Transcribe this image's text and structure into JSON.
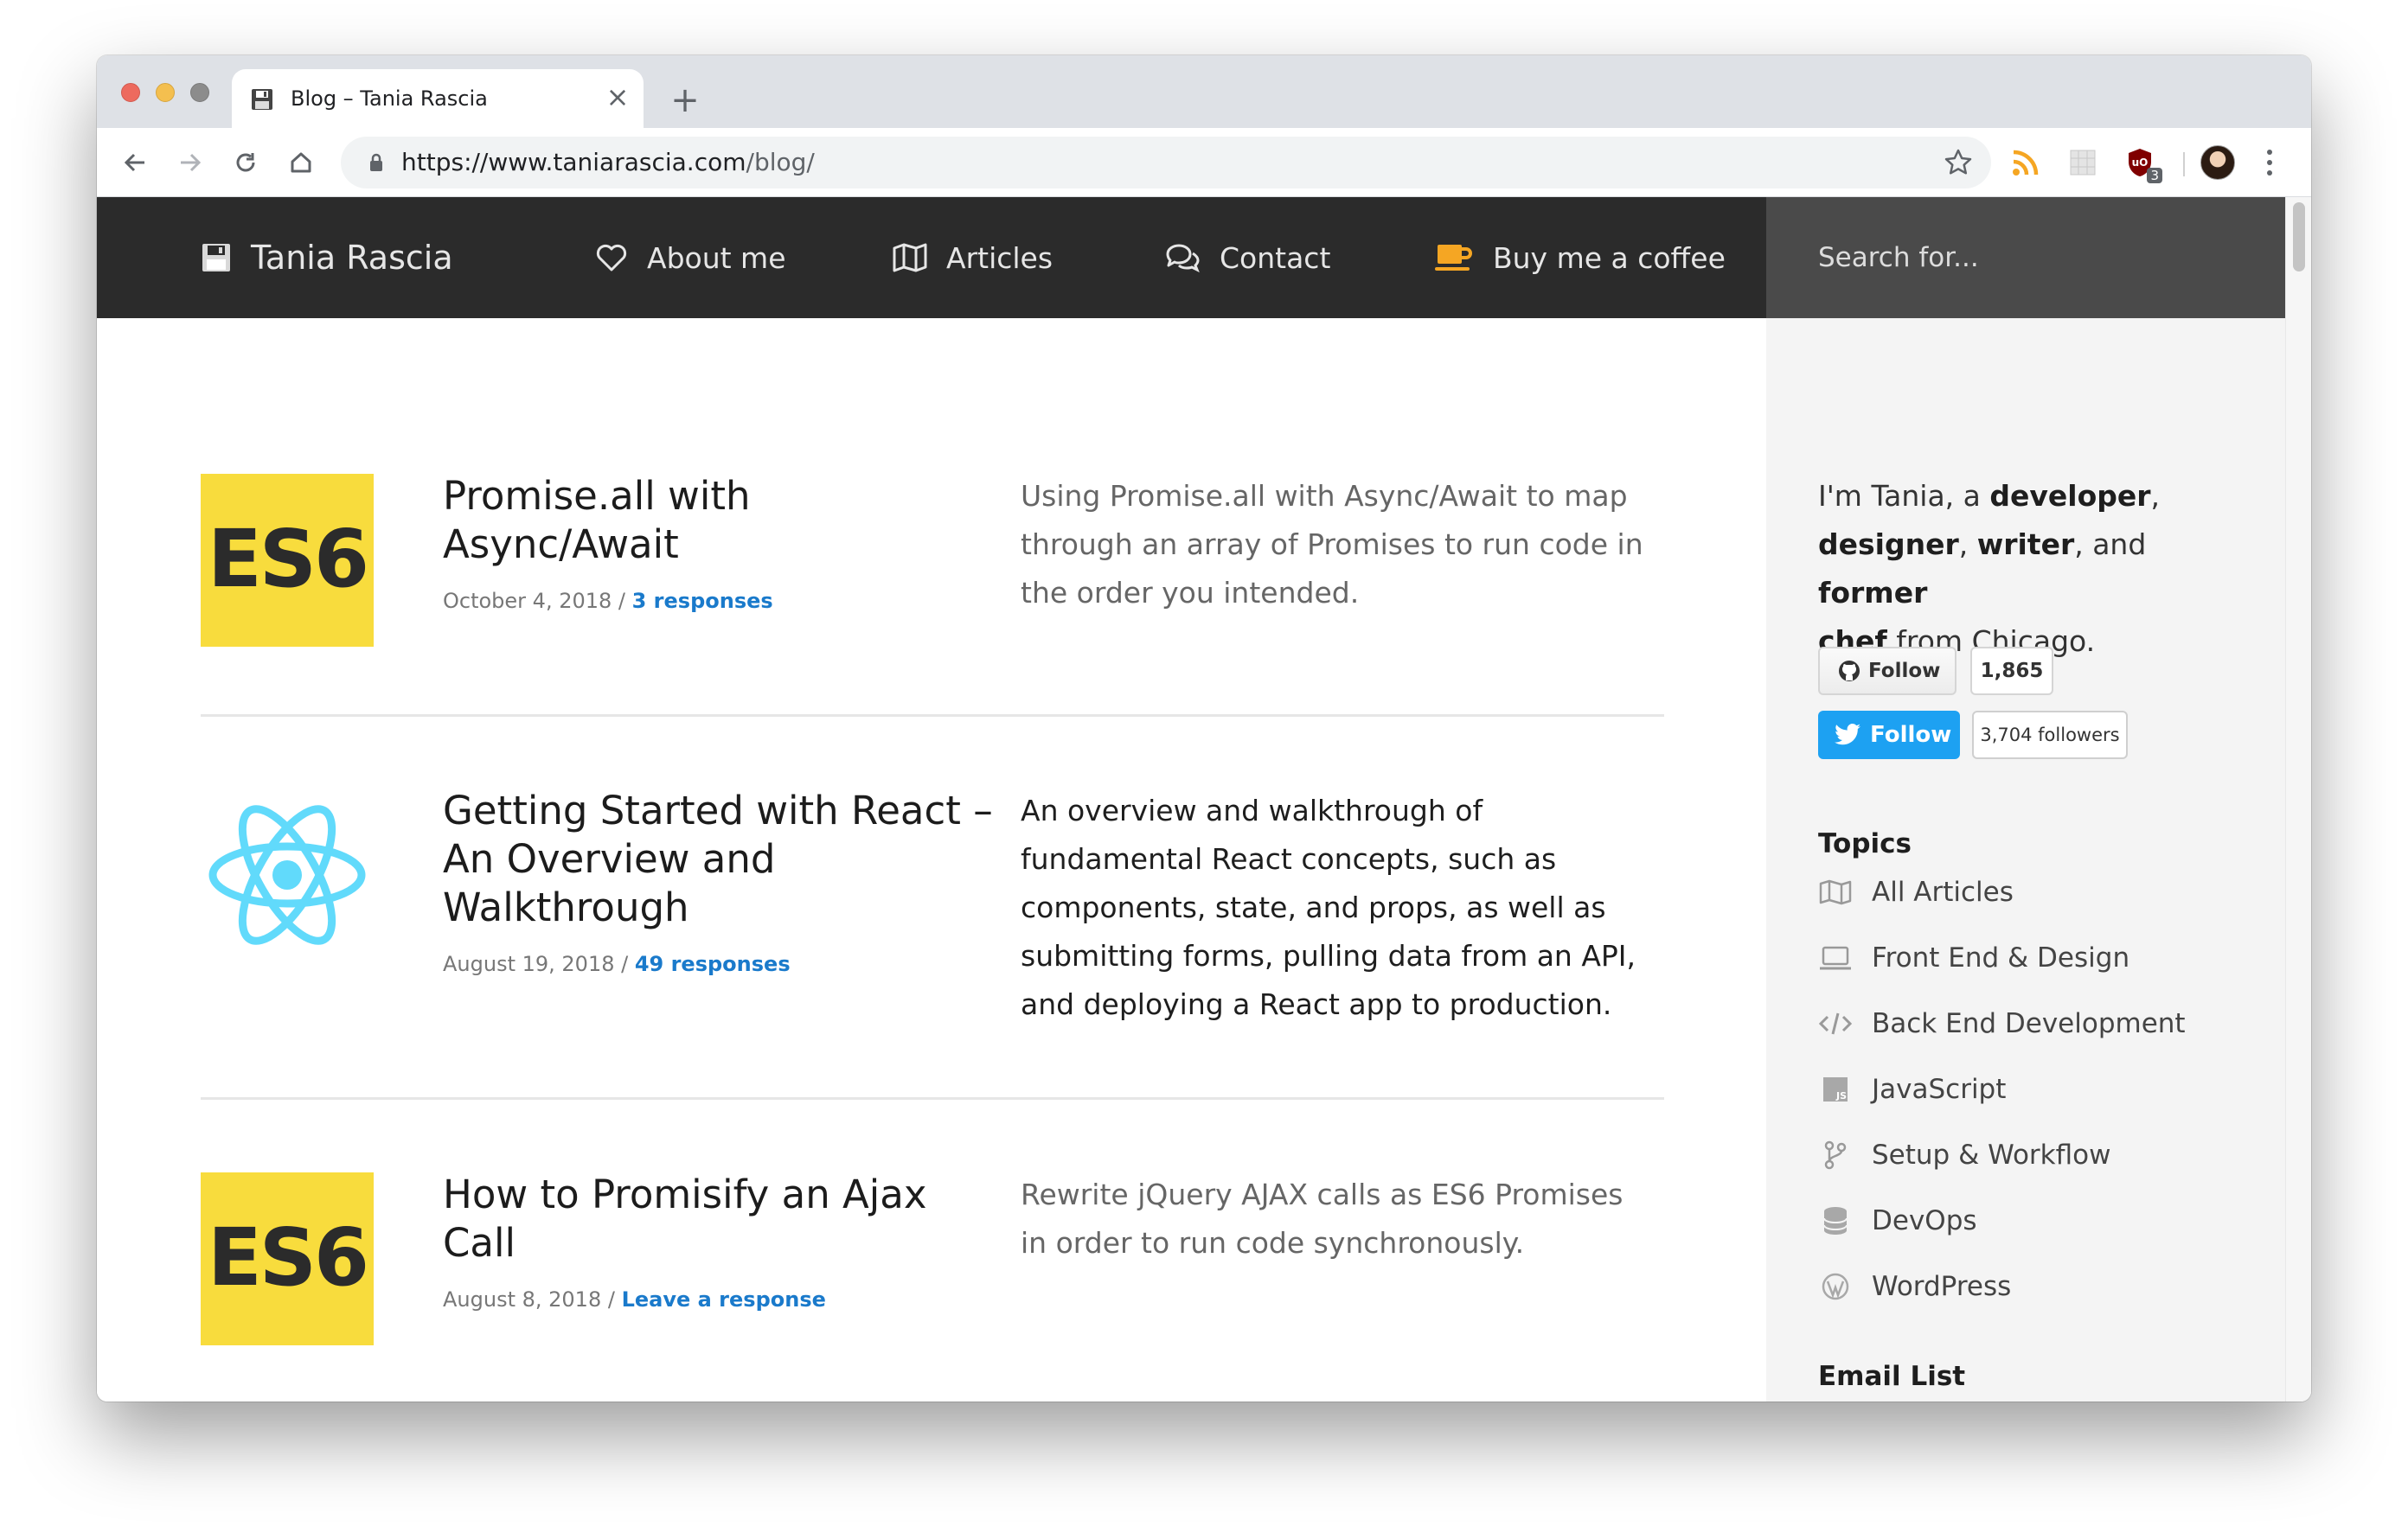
{
  "browser": {
    "tab_title": "Blog – Tania Rascia",
    "tab_close": "×",
    "new_tab": "+",
    "url_host": "https://www.taniarascia.com",
    "url_path": "/blog/",
    "extension_badge": "3"
  },
  "site": {
    "brand": "Tania Rascia",
    "nav": [
      {
        "label": "About me",
        "icon": "heart-icon"
      },
      {
        "label": "Articles",
        "icon": "map-icon"
      },
      {
        "label": "Contact",
        "icon": "chat-icon"
      },
      {
        "label": "Buy me a coffee",
        "icon": "coffee-icon"
      }
    ],
    "search_placeholder": "Search for..."
  },
  "posts": [
    {
      "thumb": "ES6",
      "title": "Promise.all with Async/Await",
      "date": "October 4, 2018",
      "sep": " / ",
      "responses": "3 responses",
      "description": "Using Promise.all with Async/Await to map through an array of Promises to run code in the order you intended."
    },
    {
      "thumb": "react-logo",
      "title": "Getting Started with React – An Overview and Walkthrough",
      "date": "August 19, 2018",
      "sep": " / ",
      "responses": "49 responses",
      "description": "An overview and walkthrough of fundamental React concepts, such as components, state, and props, as well as submitting forms, pulling data from an API, and deploying a React app to production."
    },
    {
      "thumb": "ES6",
      "title": "How to Promisify an Ajax Call",
      "date": "August 8, 2018",
      "sep": " / ",
      "responses": "Leave a response",
      "description": "Rewrite jQuery AJAX calls as ES6 Promises in order to run code synchronously."
    }
  ],
  "sidebar": {
    "bio_1": "I'm Tania, a ",
    "bio_developer": "developer",
    "bio_2": ",",
    "bio_designer": "designer",
    "bio_3": ", ",
    "bio_writer": "writer",
    "bio_4": ", and ",
    "bio_former": "former",
    "bio_chef": "chef",
    "bio_5": " from Chicago.",
    "github_follow": "Follow",
    "github_count": "1,865",
    "twitter_follow": "Follow",
    "twitter_count": "3,704 followers",
    "topics_heading": "Topics",
    "topics": [
      {
        "label": "All Articles",
        "icon": "map-icon"
      },
      {
        "label": "Front End & Design",
        "icon": "laptop-icon"
      },
      {
        "label": "Back End Development",
        "icon": "code-icon"
      },
      {
        "label": "JavaScript",
        "icon": "js-icon"
      },
      {
        "label": "Setup & Workflow",
        "icon": "git-branch-icon"
      },
      {
        "label": "DevOps",
        "icon": "database-icon"
      },
      {
        "label": "WordPress",
        "icon": "wordpress-icon"
      }
    ],
    "email_heading": "Email List"
  },
  "colors": {
    "nav_bg": "#2b2b2b",
    "search_bg": "#4a4a4a",
    "es6_yellow": "#f8dc3d",
    "react_blue": "#61dafb",
    "link_blue": "#1a7acb",
    "twitter_blue": "#1da1f2",
    "coffee_orange": "#f5a623"
  }
}
